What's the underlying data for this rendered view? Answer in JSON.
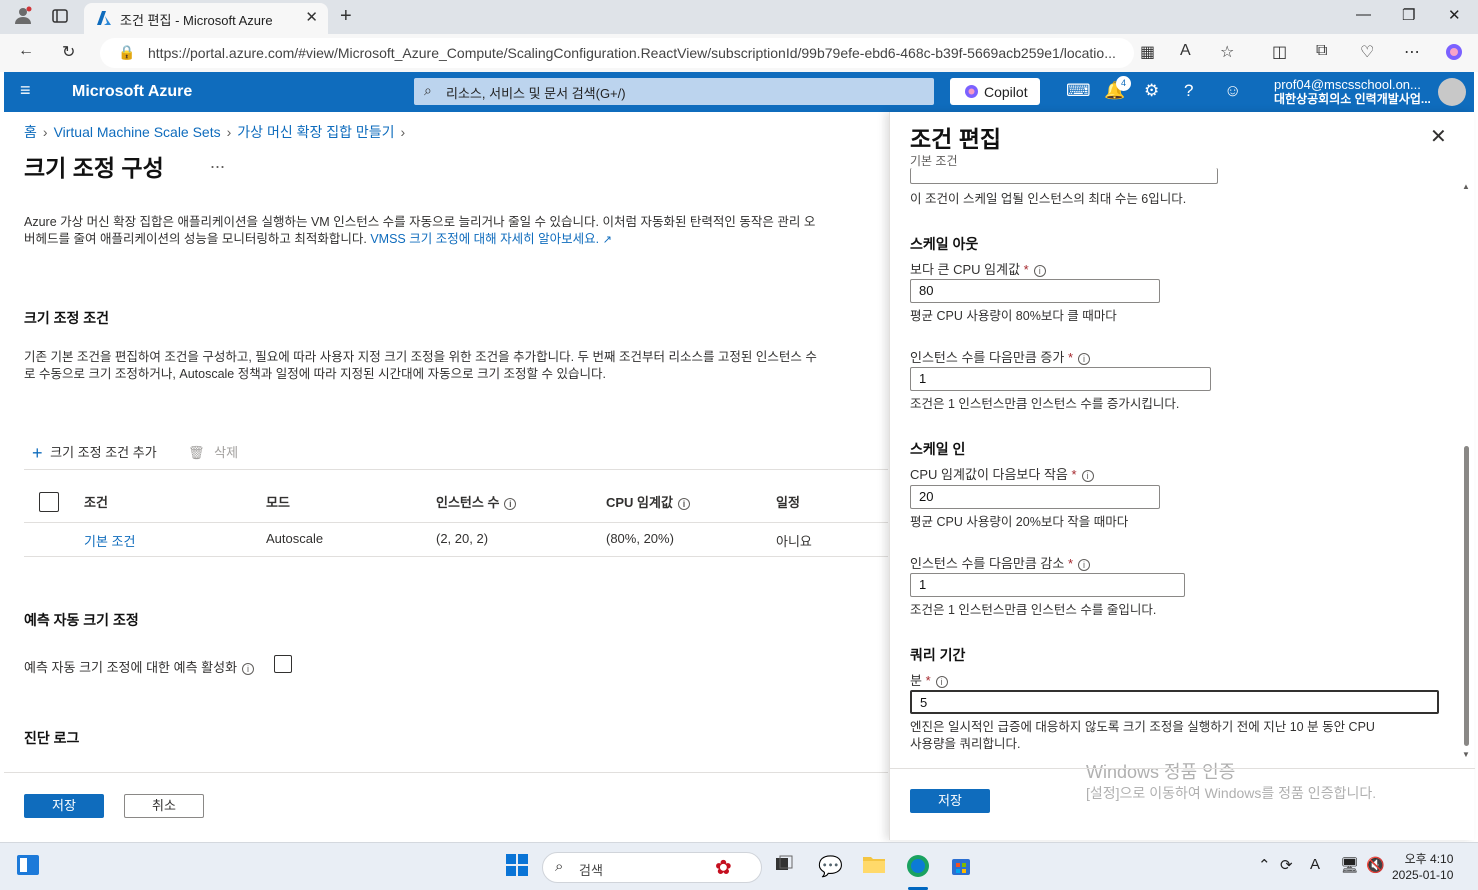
{
  "browser": {
    "tab_title": "조건 편집 - Microsoft Azure",
    "url": "https://portal.azure.com/#view/Microsoft_Azure_Compute/ScalingConfiguration.ReactView/subscriptionId/99b79efe-ebd6-468c-b39f-5669acb259e1/locatio..."
  },
  "header": {
    "brand": "Microsoft Azure",
    "search_placeholder": "리소스, 서비스 및 문서 검색(G+/)",
    "copilot_label": "Copilot",
    "notification_count": "4",
    "account_email": "prof04@mscsschool.on...",
    "account_org": "대한상공회의소 인력개발사업..."
  },
  "breadcrumb": [
    "홈",
    "Virtual Machine Scale Sets",
    "가상 머신 확장 집합 만들기"
  ],
  "page": {
    "title": "크기 조정 구성",
    "more": "...",
    "description": "Azure 가상 머신 확장 집합은 애플리케이션을 실행하는 VM 인스턴스 수를 자동으로 늘리거나 줄일 수 있습니다. 이처럼 자동화된 탄력적인 동작은 관리 오버헤드를 줄여 애플리케이션의 성능을 모니터링하고 최적화합니다.",
    "description_link": "VMSS 크기 조정에 대해 자세히 알아보세요.",
    "conditions_heading": "크기 조정 조건",
    "conditions_desc": "기존 기본 조건을 편집하여 조건을 구성하고, 필요에 따라 사용자 지정 크기 조정을 위한 조건을 추가합니다. 두 번째 조건부터 리소스를 고정된 인스턴스 수로 수동으로 크기 조정하거나, Autoscale 정책과 일정에 따라 지정된 시간대에 자동으로 크기 조정할 수 있습니다.",
    "add_condition": "크기 조정 조건 추가",
    "delete": "삭제",
    "table": {
      "headers": [
        "조건",
        "모드",
        "인스턴스 수",
        "CPU 임계값",
        "일정"
      ],
      "rows": [
        {
          "name": "기본 조건",
          "mode": "Autoscale",
          "instances": "(2, 20, 2)",
          "cpu": "(80%, 20%)",
          "schedule": "아니요"
        }
      ]
    },
    "predictive_heading": "예측 자동 크기 조정",
    "predictive_label": "예측 자동 크기 조정에 대한 예측 활성화",
    "diag_heading": "진단 로그",
    "save": "저장",
    "cancel": "취소"
  },
  "panel": {
    "title": "조건 편집",
    "subtitle": "기본 조건",
    "max_instances_help": "이 조건이 스케일 업될 인스턴스의 최대 수는 6입니다.",
    "scale_out_heading": "스케일 아웃",
    "cpu_above_label": "보다 큰 CPU 임계값",
    "cpu_above_value": "80",
    "cpu_above_help": "평균 CPU 사용량이 80%보다 클 때마다",
    "increase_label": "인스턴스 수를 다음만큼 증가",
    "increase_value": "1",
    "increase_help": "조건은 1 인스턴스만큼 인스턴스 수를 증가시킵니다.",
    "scale_in_heading": "스케일 인",
    "cpu_below_label": "CPU 임계값이 다음보다 작음",
    "cpu_below_value": "20",
    "cpu_below_help": "평균 CPU 사용량이 20%보다 작을 때마다",
    "decrease_label": "인스턴스 수를 다음만큼 감소",
    "decrease_value": "1",
    "decrease_help": "조건은 1 인스턴스만큼 인스턴스 수를 줄입니다.",
    "query_heading": "쿼리 기간",
    "minutes_label": "분",
    "minutes_value": "5",
    "query_help_1": "엔진은 일시적인 급증에 대응하지 않도록 크기 조정을 실행하기 전에 지난 10 분 동안 CPU",
    "query_help_2": "사용량을 쿼리합니다.",
    "save": "저장",
    "watermark_1": "Windows 정품 인증",
    "watermark_2": "[설정]으로 이동하여 Windows를 정품 인증합니다."
  },
  "taskbar": {
    "search": "검색",
    "time": "오후 4:10",
    "date": "2025-01-10"
  },
  "colors": {
    "azure_blue": "#0f6cbd",
    "link": "#0f6cbd"
  }
}
